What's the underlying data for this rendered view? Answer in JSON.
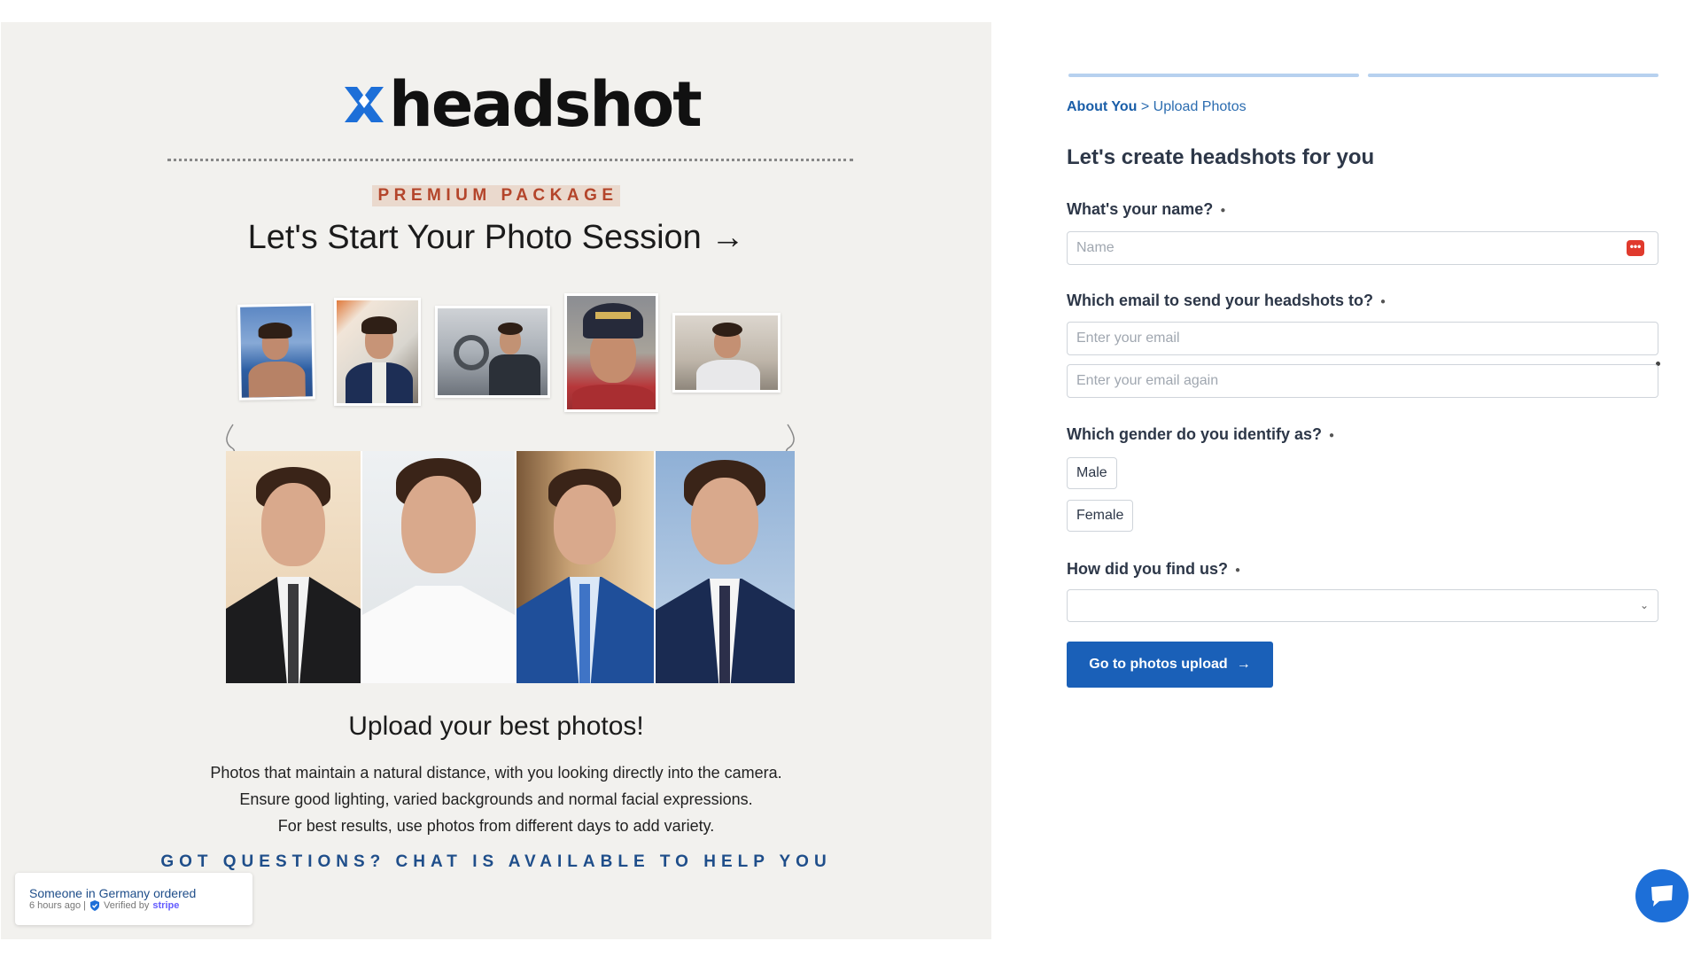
{
  "brand": {
    "name": "headshot",
    "mark_color": "#1d6fd8"
  },
  "hero": {
    "package_label": "PREMIUM PACKAGE",
    "title": "Let's Start Your Photo Session →",
    "upload_title": "Upload your best photos!",
    "upload_lines": [
      "Photos that maintain a natural distance, with you looking directly into the camera.",
      "Ensure good lighting, varied backgrounds and normal facial expressions.",
      "For best results, use photos from different days to add variety."
    ],
    "questions": "GOT QUESTIONS? CHAT IS AVAILABLE TO HELP YOU"
  },
  "toast": {
    "line1": "Someone in Germany ordered",
    "time": "6 hours ago |",
    "verified": "Verified by",
    "stripe": "stripe"
  },
  "form": {
    "steps": [
      "About You",
      "Upload Photos"
    ],
    "separator": ">",
    "title": "Let's create headshots for you",
    "name_label": "What's your name?",
    "name_placeholder": "Name",
    "email_label": "Which email to send your headshots to?",
    "email_placeholder": "Enter your email",
    "email_again_placeholder": "Enter your email again",
    "gender_label": "Which gender do you identify as?",
    "gender_options": [
      "Male",
      "Female"
    ],
    "source_label": "How did you find us?",
    "source_value": "",
    "required_mark": "●",
    "submit_label": "Go to photos upload",
    "submit_arrow": "→"
  },
  "colors": {
    "accent": "#1a60b8",
    "left_bg": "#f2f1ee",
    "premium": "#b4452b",
    "progress": "#b7d1ef"
  }
}
